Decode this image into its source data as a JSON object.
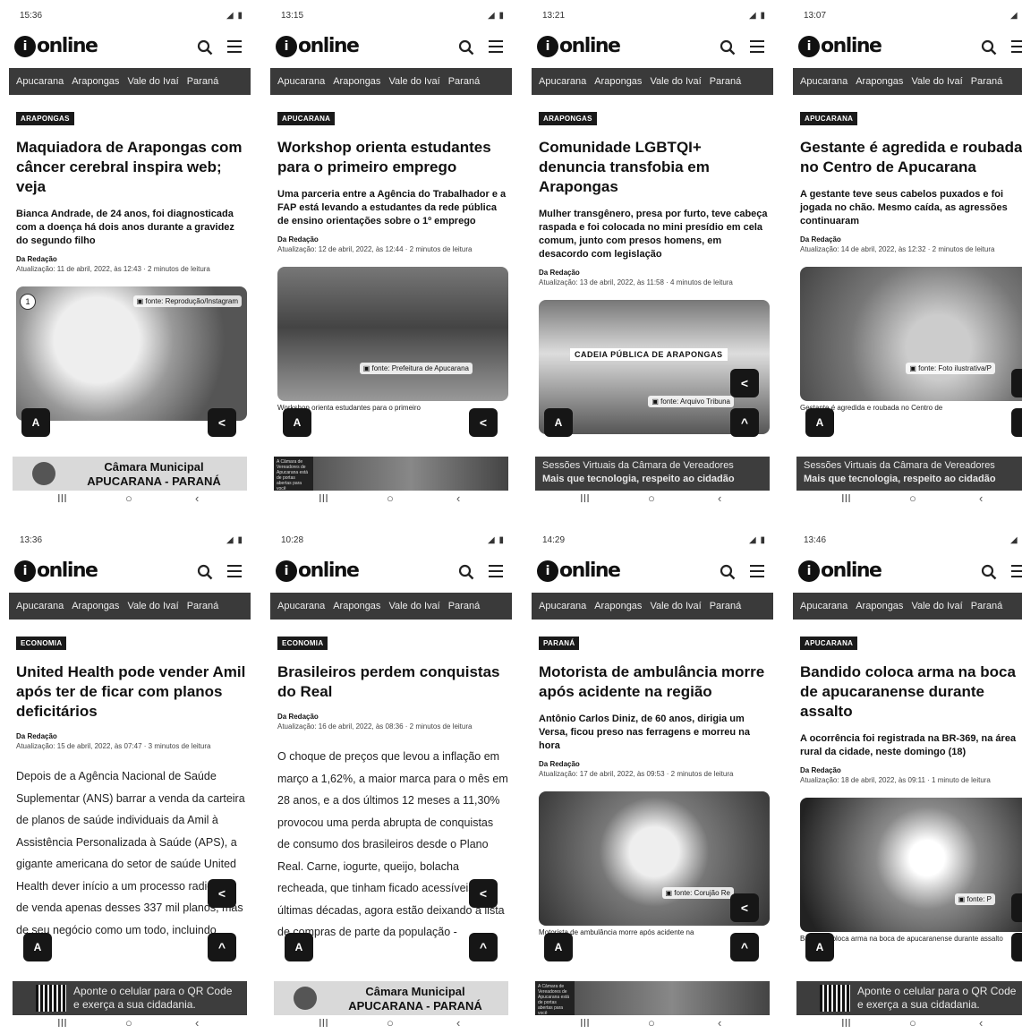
{
  "screens": [
    {
      "time": "15:36",
      "brand": "online",
      "nav": [
        "Apucarana",
        "Arapongas",
        "Vale do Ivaí",
        "Paraná"
      ],
      "category": "ARAPONGAS",
      "title": "Maquiadora de Arapongas com câncer cerebral inspira web; veja",
      "lead": "Bianca Andrade, de 24 anos, foi diagnosticada com a doença há dois anos durante a gravidez do segundo filho",
      "byline": "Da Redação",
      "updated": "Atualização: 11 de abril, 2022, às 12:43 · 2 minutos de leitura",
      "image_credit": "fonte: Reprodução/Instagram",
      "image_count": "1",
      "caption": "",
      "ad_line1": "Câmara Municipal",
      "ad_line2": "APUCARANA - PARANÁ"
    },
    {
      "time": "13:15",
      "brand": "online",
      "nav": [
        "Apucarana",
        "Arapongas",
        "Vale do Ivaí",
        "Paraná"
      ],
      "category": "APUCARANA",
      "title": "Workshop orienta estudantes para o primeiro emprego",
      "lead": "Uma parceria entre a Agência do Trabalhador e a FAP está levando a estudantes da rede pública de ensino orientações sobre o 1º emprego",
      "byline": "Da Redação",
      "updated": "Atualização: 12 de abril, 2022, às 12:44 · 2 minutos de leitura",
      "image_credit": "fonte: Prefeitura de Apucarana",
      "caption": "Workshop orienta estudantes para o primeiro",
      "ad_video": "A Câmara de Vereadores de Apucarana está de portas abertas para você"
    },
    {
      "time": "13:21",
      "brand": "online",
      "nav": [
        "Apucarana",
        "Arapongas",
        "Vale do Ivaí",
        "Paraná"
      ],
      "category": "ARAPONGAS",
      "title": "Comunidade LGBTQI+ denuncia transfobia em Arapongas",
      "lead": "Mulher transgênero, presa por furto, teve cabeça raspada e foi colocada no mini presídio em cela comum, junto com presos homens, em desacordo com legislação",
      "byline": "Da Redação",
      "updated": "Atualização: 13 de abril, 2022, às 11:58 · 4 minutos de leitura",
      "image_label": "CADEIA PÚBLICA DE ARAPONGAS",
      "image_credit": "fonte: Arquivo Tribuna",
      "caption": "",
      "ad_line1": "Sessões Virtuais da Câmara de Vereadores",
      "ad_line2": "Mais que tecnologia, respeito ao cidadão"
    },
    {
      "time": "13:07",
      "brand": "online",
      "nav": [
        "Apucarana",
        "Arapongas",
        "Vale do Ivaí",
        "Paraná"
      ],
      "category": "APUCARANA",
      "title": "Gestante é agredida e roubada no Centro de Apucarana",
      "lead": "A gestante teve seus cabelos puxados e foi jogada no chão. Mesmo caída, as agressões continuaram",
      "byline": "Da Redação",
      "updated": "Atualização: 14 de abril, 2022, às 12:32 · 2 minutos de leitura",
      "image_credit": "fonte: Foto ilustrativa/P",
      "caption": "Gestante é agredida e roubada no Centro de",
      "ad_line1": "Sessões Virtuais da Câmara de Vereadores",
      "ad_line2": "Mais que tecnologia, respeito ao cidadão"
    },
    {
      "time": "13:36",
      "brand": "online",
      "nav": [
        "Apucarana",
        "Arapongas",
        "Vale do Ivaí",
        "Paraná"
      ],
      "category": "ECONOMIA",
      "title": "United Health pode vender Amil após ter de ficar com planos deficitários",
      "lead": "",
      "byline": "Da Redação",
      "updated": "Atualização: 15 de abril, 2022, às 07:47 · 3 minutos de leitura",
      "text": "Depois de a Agência Nacional de Saúde Suplementar (ANS) barrar a venda da carteira de planos de saúde individuais da Amil à Assistência Personalizada à Saúde (APS), a gigante americana do setor de saúde United Health dever início a um processo radical: o de venda apenas desses 337 mil planos, mas de seu negócio como um todo, incluindo",
      "ad_line1": "Aponte o celular para o QR Code",
      "ad_line2": "e exerça a sua cidadania."
    },
    {
      "time": "10:28",
      "brand": "online",
      "nav": [
        "Apucarana",
        "Arapongas",
        "Vale do Ivaí",
        "Paraná"
      ],
      "category": "ECONOMIA",
      "title": "Brasileiros perdem conquistas do Real",
      "lead": "",
      "byline": "Da Redação",
      "updated": "Atualização: 16 de abril, 2022, às 08:36 · 2 minutos de leitura",
      "text": "O choque de preços que levou a inflação em março a 1,62%, a maior marca para o mês em 28 anos, e a dos últimos 12 meses a 11,30% provocou uma perda abrupta de conquistas de consumo dos brasileiros desde o Plano Real. Carne, iogurte, queijo, bolacha recheada, que tinham ficado acessíveis nas últimas décadas, agora estão deixando a lista de compras de parte da população -",
      "ad_line1": "Câmara Municipal",
      "ad_line2": "APUCARANA - PARANÁ"
    },
    {
      "time": "14:29",
      "brand": "online",
      "nav": [
        "Apucarana",
        "Arapongas",
        "Vale do Ivaí",
        "Paraná"
      ],
      "category": "PARANÁ",
      "title": "Motorista de ambulância morre após acidente na região",
      "lead": "Antônio Carlos Diniz, de 60 anos, dirigia um Versa, ficou preso nas ferragens e morreu na hora",
      "byline": "Da Redação",
      "updated": "Atualização: 17 de abril, 2022, às 09:53 · 2 minutos de leitura",
      "image_credit": "fonte: Corujão Re",
      "caption": "Motorista de ambulância morre após acidente na",
      "ad_video": "A Câmara de Vereadores de Apucarana está de portas abertas para você"
    },
    {
      "time": "13:46",
      "brand": "online",
      "nav": [
        "Apucarana",
        "Arapongas",
        "Vale do Ivaí",
        "Paraná"
      ],
      "category": "APUCARANA",
      "title": "Bandido coloca arma na boca de apucaranense durante assalto",
      "lead": "A ocorrência foi registrada na BR-369, na área rural da cidade, neste domingo (18)",
      "byline": "Da Redação",
      "updated": "Atualização: 18 de abril, 2022, às 09:11 · 1 minuto de leitura",
      "image_credit": "fonte: P",
      "caption": "Bandido coloca arma na boca de apucaranense durante assalto",
      "ad_line1": "Aponte o celular para o QR Code",
      "ad_line2": "e exerça a sua cidadania."
    }
  ],
  "icons": {
    "search": "search-icon",
    "menu": "hamburger-menu-icon",
    "share": "share-icon",
    "font": "font-size-icon",
    "up": "chevron-up-icon"
  },
  "sysnav": {
    "recents": "III",
    "home": "○",
    "back": "‹"
  },
  "font_button": "A",
  "share_glyph": "<",
  "up_glyph": "^",
  "colors": {
    "nav_bg": "#3a3a3a",
    "fab_bg": "#161616",
    "category_bg": "#1a1a1a"
  }
}
